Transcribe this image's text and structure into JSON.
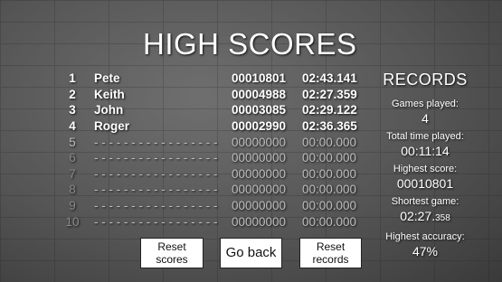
{
  "title": "HIGH SCORES",
  "scores": [
    {
      "rank": "1",
      "name": "Pete",
      "score": "00010801",
      "time": "02:43.141"
    },
    {
      "rank": "2",
      "name": "Keith",
      "score": "00004988",
      "time": "02:27.359"
    },
    {
      "rank": "3",
      "name": "John",
      "score": "00003085",
      "time": "02:29.122"
    },
    {
      "rank": "4",
      "name": "Roger",
      "score": "00002990",
      "time": "02:36.365"
    },
    {
      "rank": "5",
      "name": "- - - - - - - - - - - - - - - - -",
      "score": "00000000",
      "time": "00:00.000"
    },
    {
      "rank": "6",
      "name": "- - - - - - - - - - - - - - - - -",
      "score": "00000000",
      "time": "00:00.000"
    },
    {
      "rank": "7",
      "name": "- - - - - - - - - - - - - - - - -",
      "score": "00000000",
      "time": "00:00.000"
    },
    {
      "rank": "8",
      "name": "- - - - - - - - - - - - - - - - -",
      "score": "00000000",
      "time": "00:00.000"
    },
    {
      "rank": "9",
      "name": "- - - - - - - - - - - - - - - - -",
      "score": "00000000",
      "time": "00:00.000"
    },
    {
      "rank": "10",
      "name": "- - - - - - - - - - - - - - - - -",
      "score": "00000000",
      "time": "00:00.000"
    }
  ],
  "records": {
    "title": "RECORDS",
    "games_played_label": "Games played:",
    "games_played": "4",
    "total_time_label": "Total time played:",
    "total_time": "00:11:14",
    "highest_score_label": "Highest score:",
    "highest_score": "00010801",
    "shortest_game_label": "Shortest game:",
    "shortest_game_main": "02:27.",
    "shortest_game_ms": "358",
    "highest_accuracy_label": "Highest accuracy:",
    "highest_accuracy": "47%"
  },
  "buttons": {
    "reset_scores": "Reset\nscores",
    "go_back": "Go back",
    "reset_records": "Reset\nrecords"
  }
}
